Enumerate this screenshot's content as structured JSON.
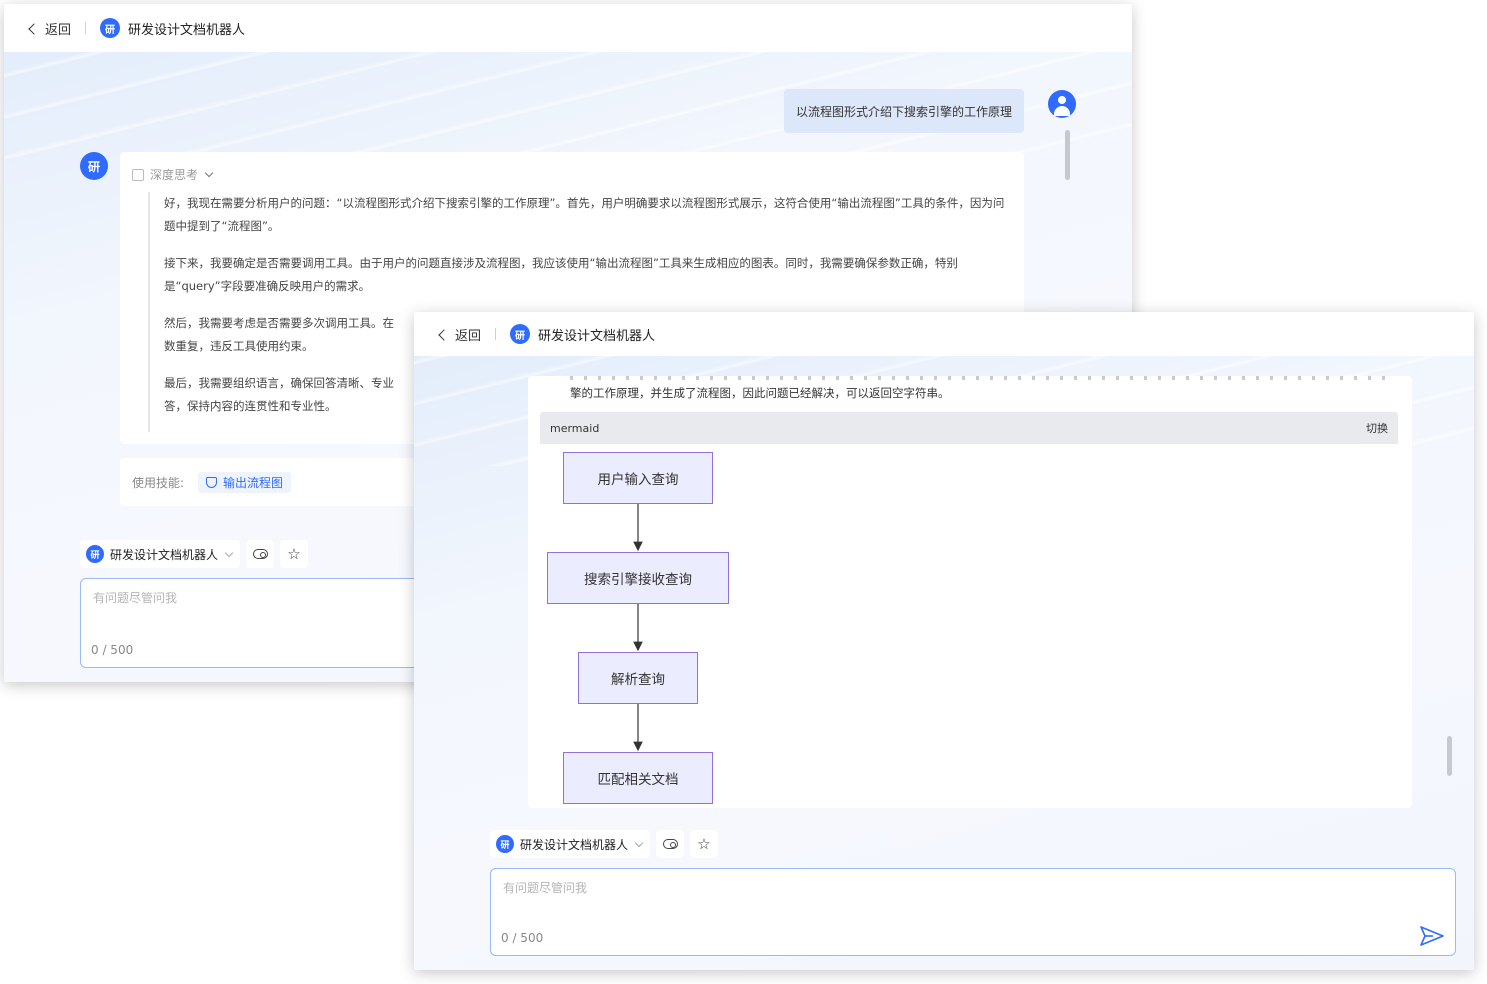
{
  "nav": {
    "back_label": "返回",
    "bot_avatar_text": "研",
    "bot_name": "研发设计文档机器人"
  },
  "conversation": {
    "user_question": "以流程图形式介绍下搜索引擎的工作原理",
    "think_label": "深度思考",
    "think_paragraphs": [
      "好，我现在需要分析用户的问题：“以流程图形式介绍下搜索引擎的工作原理”。首先，用户明确要求以流程图形式展示，这符合使用“输出流程图”工具的条件，因为问题中提到了“流程图”。",
      "接下来，我要确定是否需要调用工具。由于用户的问题直接涉及流程图，我应该使用“输出流程图”工具来生成相应的图表。同时，我需要确保参数正确，特别是“query”字段要准确反映用户的需求。",
      "然后，我需要考虑是否需要多次调用工具。在",
      "数重复，违反工具使用约束。",
      "最后，我需要组织语言，确保回答清晰、专业",
      "答，保持内容的连贯性和专业性。"
    ],
    "skills_label": "使用技能:",
    "skill_chip": "输出流程图",
    "answer_tail": "擎的工作原理，并生成了流程图，因此问题已经解决，可以返回空字符串。",
    "code_lang": "mermaid",
    "switch_label": "切换",
    "flow_nodes": [
      "用户输入查询",
      "搜索引擎接收查询",
      "解析查询",
      "匹配相关文档"
    ]
  },
  "composer": {
    "robot_name": "研发设计文档机器人",
    "placeholder": "有问题尽管问我",
    "counter": "0 / 500"
  },
  "icons": {
    "back": "chevron-left-icon",
    "user": "user-avatar-icon",
    "cloud": "cloud-icon",
    "star": "star-icon",
    "send": "send-icon"
  },
  "colors": {
    "accent": "#2f6bff",
    "flow_node_fill": "#ececff",
    "flow_node_border": "#9370db"
  }
}
